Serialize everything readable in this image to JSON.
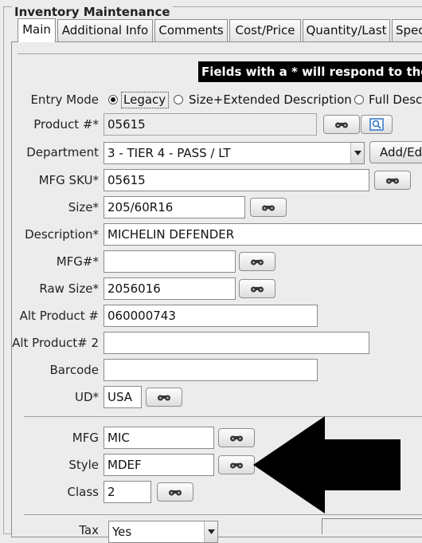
{
  "window": {
    "title": "Inventory Maintenance"
  },
  "tabs": [
    {
      "label": "Main",
      "active": true
    },
    {
      "label": "Additional Info"
    },
    {
      "label": "Comments"
    },
    {
      "label": "Cost/Price"
    },
    {
      "label": "Quantity/Last"
    },
    {
      "label": "Spec"
    }
  ],
  "banner": {
    "text": "Fields with a * will respond to the P"
  },
  "entry_mode": {
    "label": "Entry Mode",
    "options": [
      "Legacy",
      "Size+Extended Description",
      "Full Desc"
    ],
    "selected": "Legacy"
  },
  "fields": {
    "product": {
      "label": "Product #*",
      "value": "05615"
    },
    "department": {
      "label": "Department",
      "value": "3 - TIER 4 - PASS / LT",
      "add_button": "Add/Ed"
    },
    "mfg_sku": {
      "label": "MFG SKU*",
      "value": "05615"
    },
    "size": {
      "label": "Size*",
      "value": "205/60R16"
    },
    "description": {
      "label": "Description*",
      "value": "MICHELIN DEFENDER"
    },
    "mfg_num": {
      "label": "MFG#*",
      "value": ""
    },
    "raw_size": {
      "label": "Raw Size*",
      "value": "2056016"
    },
    "alt_product": {
      "label": "Alt Product #",
      "value": "060000743"
    },
    "alt_product2": {
      "label": "Alt Product# 2",
      "value": ""
    },
    "barcode": {
      "label": "Barcode",
      "value": ""
    },
    "ud": {
      "label": "UD*",
      "value": "USA"
    },
    "mfg": {
      "label": "MFG",
      "value": "MIC"
    },
    "style": {
      "label": "Style",
      "value": "MDEF"
    },
    "class": {
      "label": "Class",
      "value": "2"
    },
    "tax": {
      "label": "Tax",
      "value": "Yes"
    }
  },
  "icons": {
    "lookup": "binoculars-icon",
    "preview": "magnifier-icon",
    "dropdown": "chevron-down-icon",
    "annotation": "arrow-left-icon"
  },
  "colors": {
    "banner_bg": "#000000",
    "banner_text": "#ffffff",
    "panel_bg": "#ececec",
    "preview_accent": "#2e73c8"
  }
}
